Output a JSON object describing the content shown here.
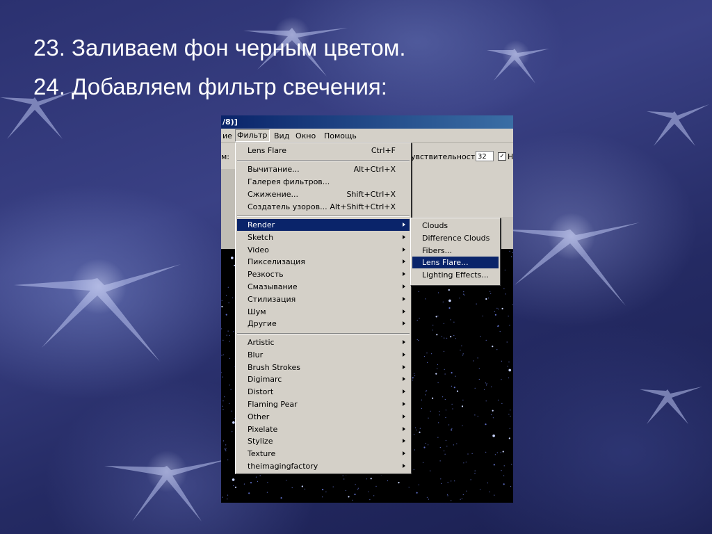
{
  "slide": {
    "line1": "23. Заливаем фон черным цветом.",
    "line2": "24. Добавляем фильтр свечения:"
  },
  "screenshot": {
    "title_fragment": "/8)]",
    "menubar": [
      {
        "label": "ие"
      },
      {
        "label": "Фильтр"
      },
      {
        "label": "Вид"
      },
      {
        "label": "Окно"
      },
      {
        "label": "Помощь"
      }
    ],
    "options": {
      "left_label": "м:",
      "sensitivity_label": "увствительность:",
      "sensitivity_value": "32",
      "checkbox_mark": "✓",
      "after_check_label": "Н"
    },
    "filter_menu": {
      "last_filter": {
        "label": "Lens Flare",
        "shortcut": "Ctrl+F"
      },
      "group1": [
        {
          "label": "Вычитание...",
          "shortcut": "Alt+Ctrl+X"
        },
        {
          "label": "Галерея фильтров...",
          "shortcut": ""
        },
        {
          "label": "Сжижение...",
          "shortcut": "Shift+Ctrl+X"
        },
        {
          "label": "Создатель узоров...",
          "shortcut": "Alt+Shift+Ctrl+X"
        }
      ],
      "group2": [
        {
          "label": "Render"
        },
        {
          "label": "Sketch"
        },
        {
          "label": "Video"
        },
        {
          "label": "Пикселизация"
        },
        {
          "label": "Резкость"
        },
        {
          "label": "Смазывание"
        },
        {
          "label": "Стилизация"
        },
        {
          "label": "Шум"
        },
        {
          "label": "Другие"
        }
      ],
      "group3": [
        {
          "label": "Artistic"
        },
        {
          "label": "Blur"
        },
        {
          "label": "Brush Strokes"
        },
        {
          "label": "Digimarc"
        },
        {
          "label": "Distort"
        },
        {
          "label": "Flaming Pear"
        },
        {
          "label": "Other"
        },
        {
          "label": "Pixelate"
        },
        {
          "label": "Stylize"
        },
        {
          "label": "Texture"
        },
        {
          "label": "theimagingfactory"
        }
      ]
    },
    "render_submenu": [
      {
        "label": "Clouds"
      },
      {
        "label": "Difference Clouds"
      },
      {
        "label": "Fibers..."
      },
      {
        "label": "Lens Flare..."
      },
      {
        "label": "Lighting Effects..."
      }
    ],
    "colors": {
      "highlight": "#0a246a",
      "menu_bg": "#d4d0c8"
    }
  }
}
